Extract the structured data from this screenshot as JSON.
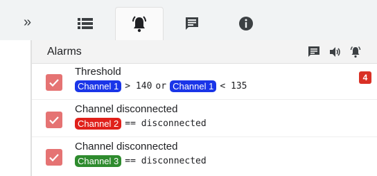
{
  "tabs": [
    {
      "icon": "list-icon",
      "active": false
    },
    {
      "icon": "bell-ringing-icon",
      "active": true
    },
    {
      "icon": "message-icon",
      "active": false
    },
    {
      "icon": "info-icon",
      "active": false
    }
  ],
  "collapse": {
    "label": "»",
    "icon": "double-chevron-right-icon"
  },
  "panel": {
    "title": "Alarms",
    "header_icons": [
      "message-icon",
      "volume-icon",
      "bell-ringing-icon"
    ]
  },
  "colors": {
    "check": "#e57373",
    "channel1": "#1a35e8",
    "channel2": "#e0201a",
    "channel3": "#2e8b2e",
    "badge": "#d93025"
  },
  "alarms": [
    {
      "name": "Threshold",
      "chip1": "Channel 1",
      "op1": "> 140",
      "mid": "or",
      "chip2": "Channel 1",
      "op2": "< 135",
      "count": "4"
    },
    {
      "name": "Channel disconnected",
      "chip1": "Channel 2",
      "op1": "== disconnected"
    },
    {
      "name": "Channel disconnected",
      "chip1": "Channel 3",
      "op1": "== disconnected"
    }
  ]
}
